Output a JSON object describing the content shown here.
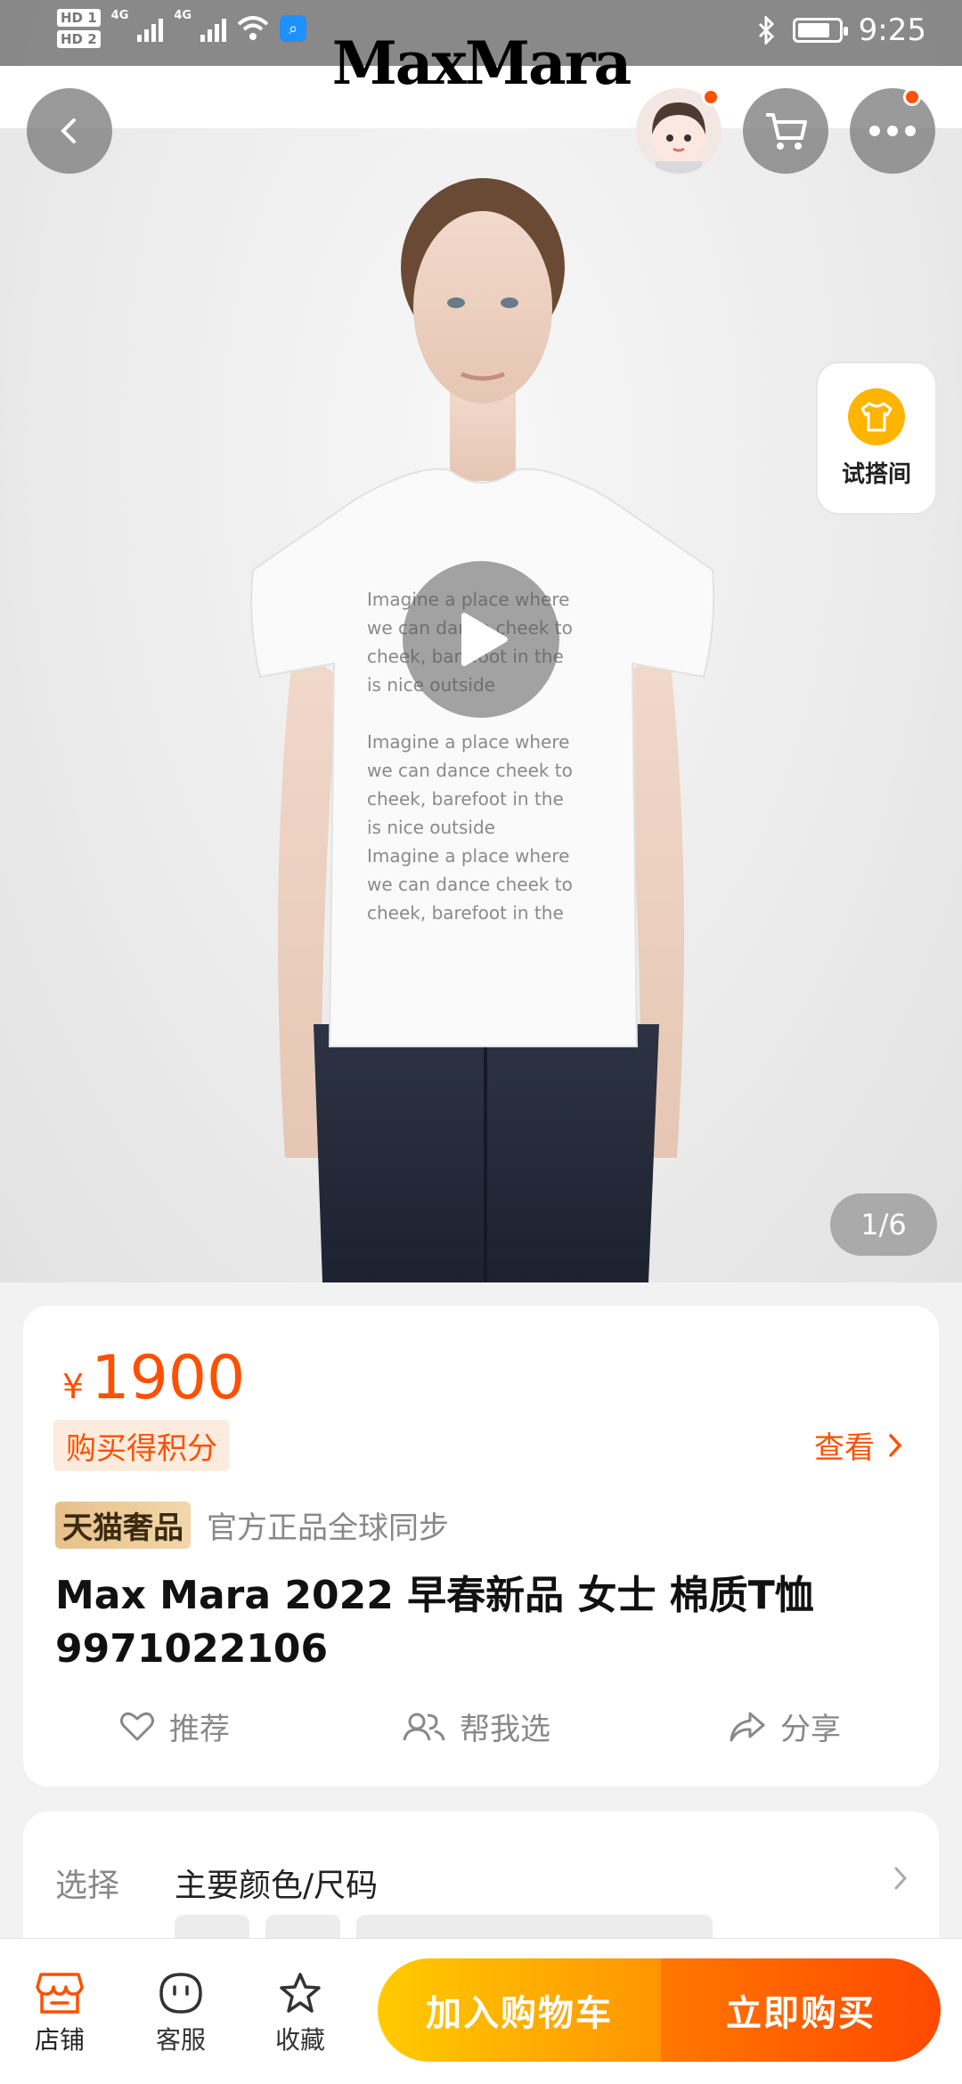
{
  "status_bar": {
    "hd1": "HD 1",
    "hd2": "HD 2",
    "net1": "4G",
    "net2": "4G",
    "time": "9:25"
  },
  "header": {
    "brand": "MaxMara"
  },
  "gallery": {
    "fitting_room_label": "试搭间",
    "page_indicator": "1/6",
    "shirt_text_lines": [
      "Imagine a place where",
      "we can dance cheek to",
      "cheek, barefoot in the",
      "is nice outside"
    ]
  },
  "price_card": {
    "currency": "¥",
    "price": "1900",
    "points_tag": "购买得积分",
    "view_link": "查看",
    "tmall_badge": "天猫奢品",
    "tmall_text": "官方正品全球同步",
    "title_line1": "Max Mara 2022 早春新品 女士 棉质T恤",
    "title_line2": "9971022106",
    "actions": {
      "recommend": "推荐",
      "help_choose": "帮我选",
      "share": "分享"
    }
  },
  "select_card": {
    "label": "选择",
    "value": "主要颜色/尺码"
  },
  "bottom_bar": {
    "shop": "店铺",
    "service": "客服",
    "favorite": "收藏",
    "add_to_cart": "加入购物车",
    "buy_now": "立即购买"
  },
  "colors": {
    "accent": "#ff5000",
    "cart_gradient": [
      "#ffcb00",
      "#ff9402"
    ],
    "buy_gradient": [
      "#ff7700",
      "#ff4900"
    ]
  }
}
